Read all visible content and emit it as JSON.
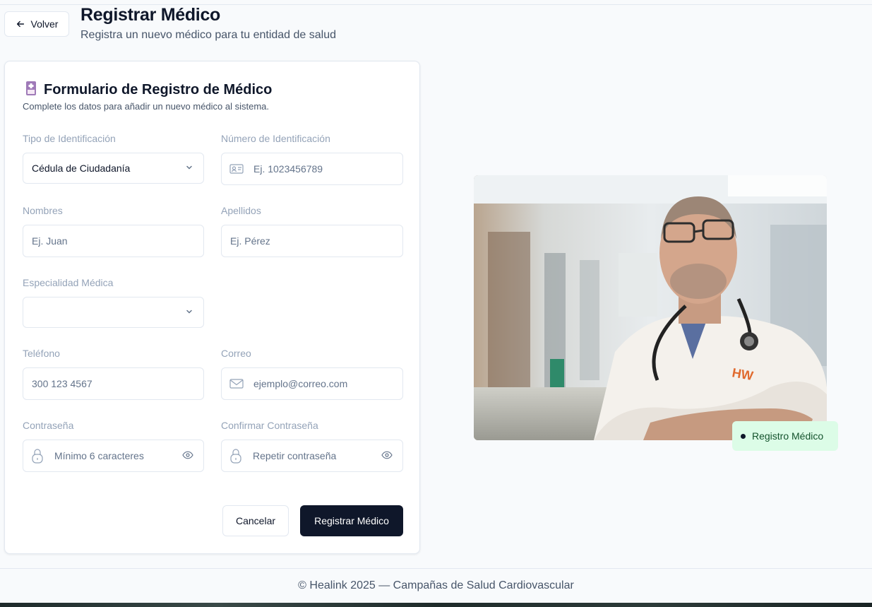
{
  "header": {
    "back_label": "Volver",
    "title": "Registrar Médico",
    "subtitle": "Registra un nuevo médico para tu entidad de salud"
  },
  "form": {
    "title": "Formulario de Registro de Médico",
    "description": "Complete los datos para añadir un nuevo médico al sistema.",
    "id_type": {
      "label": "Tipo de Identificación",
      "value": "Cédula de Ciudadanía"
    },
    "id_number": {
      "label": "Número de Identificación",
      "placeholder": "Ej. 1023456789"
    },
    "first_name": {
      "label": "Nombres",
      "placeholder": "Ej. Juan"
    },
    "last_name": {
      "label": "Apellidos",
      "placeholder": "Ej. Pérez"
    },
    "specialty": {
      "label": "Especialidad Médica",
      "value": ""
    },
    "phone": {
      "label": "Teléfono",
      "placeholder": "300 123 4567"
    },
    "email": {
      "label": "Correo",
      "placeholder": "ejemplo@correo.com"
    },
    "password": {
      "label": "Contraseña",
      "placeholder": "Mínimo 6 caracteres"
    },
    "confirm_password": {
      "label": "Confirmar Contraseña",
      "placeholder": "Repetir contraseña"
    },
    "cancel_label": "Cancelar",
    "submit_label": "Registrar Médico"
  },
  "side": {
    "badge_label": "Registro Médico"
  },
  "footer": {
    "text": "© Healink 2025 — Campañas de Salud Cardiovascular"
  },
  "colors": {
    "primary": "#0f172a",
    "badge_bg": "#dcfce7",
    "border": "#e2e8f0"
  }
}
